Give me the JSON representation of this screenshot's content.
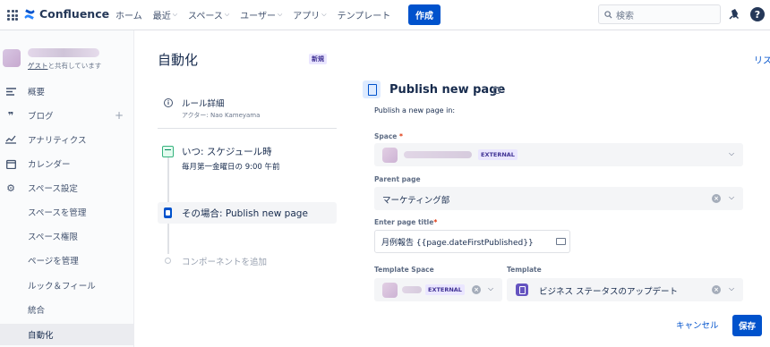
{
  "topnav": {
    "brand": "Confluence",
    "items": [
      {
        "label": "ホーム",
        "has_menu": false
      },
      {
        "label": "最近",
        "has_menu": true
      },
      {
        "label": "スペース",
        "has_menu": true
      },
      {
        "label": "ユーザー",
        "has_menu": true
      },
      {
        "label": "アプリ",
        "has_menu": true
      },
      {
        "label": "テンプレート",
        "has_menu": false
      }
    ],
    "create_label": "作成",
    "search_placeholder": "検索",
    "help_label": "?"
  },
  "sidebar": {
    "space_subtitle_link": "ゲスト",
    "space_subtitle_rest": "と共有しています",
    "items": [
      {
        "label": "概要",
        "icon": "overview-icon"
      },
      {
        "label": "ブログ",
        "icon": "quote-icon",
        "plus": "+"
      },
      {
        "label": "アナリティクス",
        "icon": "analytics-icon"
      },
      {
        "label": "カレンダー",
        "icon": "calendar-icon"
      },
      {
        "label": "スペース設定",
        "icon": "gear-icon"
      },
      {
        "label": "スペースを管理"
      },
      {
        "label": "スペース権限"
      },
      {
        "label": "ページを管理"
      },
      {
        "label": "ルック＆フィール"
      },
      {
        "label": "統合"
      },
      {
        "label": "自動化",
        "active": true
      }
    ]
  },
  "rule": {
    "page_title": "自動化",
    "new_badge": "新規",
    "detail_title": "ルール詳細",
    "actor": "アクター: Nao Kameyama",
    "trigger_title": "いつ: スケジュール時",
    "trigger_subtitle": "毎月第一金曜日の 9:00 午前",
    "action_title": "その場合: Publish new page",
    "add_component": "コンポーネントを追加"
  },
  "panel": {
    "list_link": "リス",
    "title": "Publish new page",
    "subtitle": "Publish a new page in:",
    "space_label": "Space",
    "required_mark": "*",
    "space_badge": "EXTERNAL",
    "parent_label": "Parent page",
    "parent_value": "マーケティング部",
    "title_label": "Enter page title",
    "title_value": "月例報告 {{page.dateFirstPublished}}",
    "template_space_label": "Template Space",
    "template_space_badge": "EXTERNAL",
    "template_label": "Template",
    "template_value": "ビジネス ステータスのアップデート",
    "cancel_label": "キャンセル",
    "save_label": "保存"
  },
  "colors": {
    "brand_blue": "#0052cc",
    "badge_purple": "#403294",
    "template_icon": "#6554c0"
  }
}
